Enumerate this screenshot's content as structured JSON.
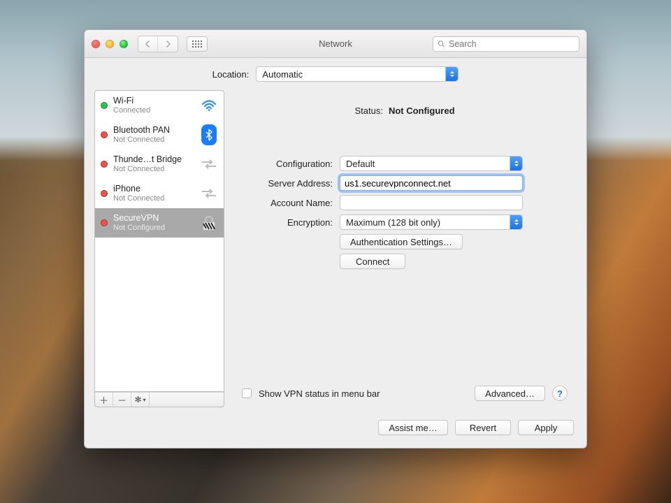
{
  "titlebar": {
    "title": "Network",
    "search_placeholder": "Search"
  },
  "location": {
    "label": "Location:",
    "value": "Automatic"
  },
  "sidebar": {
    "items": [
      {
        "name": "Wi-Fi",
        "status": "Connected",
        "dot": "green",
        "icon": "wifi"
      },
      {
        "name": "Bluetooth PAN",
        "status": "Not Connected",
        "dot": "red",
        "icon": "bluetooth"
      },
      {
        "name": "Thunde…t Bridge",
        "status": "Not Connected",
        "dot": "red",
        "icon": "sync"
      },
      {
        "name": "iPhone",
        "status": "Not Connected",
        "dot": "red",
        "icon": "sync"
      },
      {
        "name": "SecureVPN",
        "status": "Not Configured",
        "dot": "red",
        "icon": "lock",
        "selected": true
      }
    ]
  },
  "main": {
    "status_label": "Status:",
    "status_value": "Not Configured",
    "config_label": "Configuration:",
    "config_value": "Default",
    "server_label": "Server Address:",
    "server_value": "us1.securevpnconnect.net",
    "account_label": "Account Name:",
    "account_value": "",
    "encryption_label": "Encryption:",
    "encryption_value": "Maximum (128 bit only)",
    "auth_button": "Authentication Settings…",
    "connect_button": "Connect",
    "show_vpn_label": "Show VPN status in menu bar",
    "advanced_button": "Advanced…"
  },
  "footer": {
    "assist": "Assist me…",
    "revert": "Revert",
    "apply": "Apply"
  }
}
